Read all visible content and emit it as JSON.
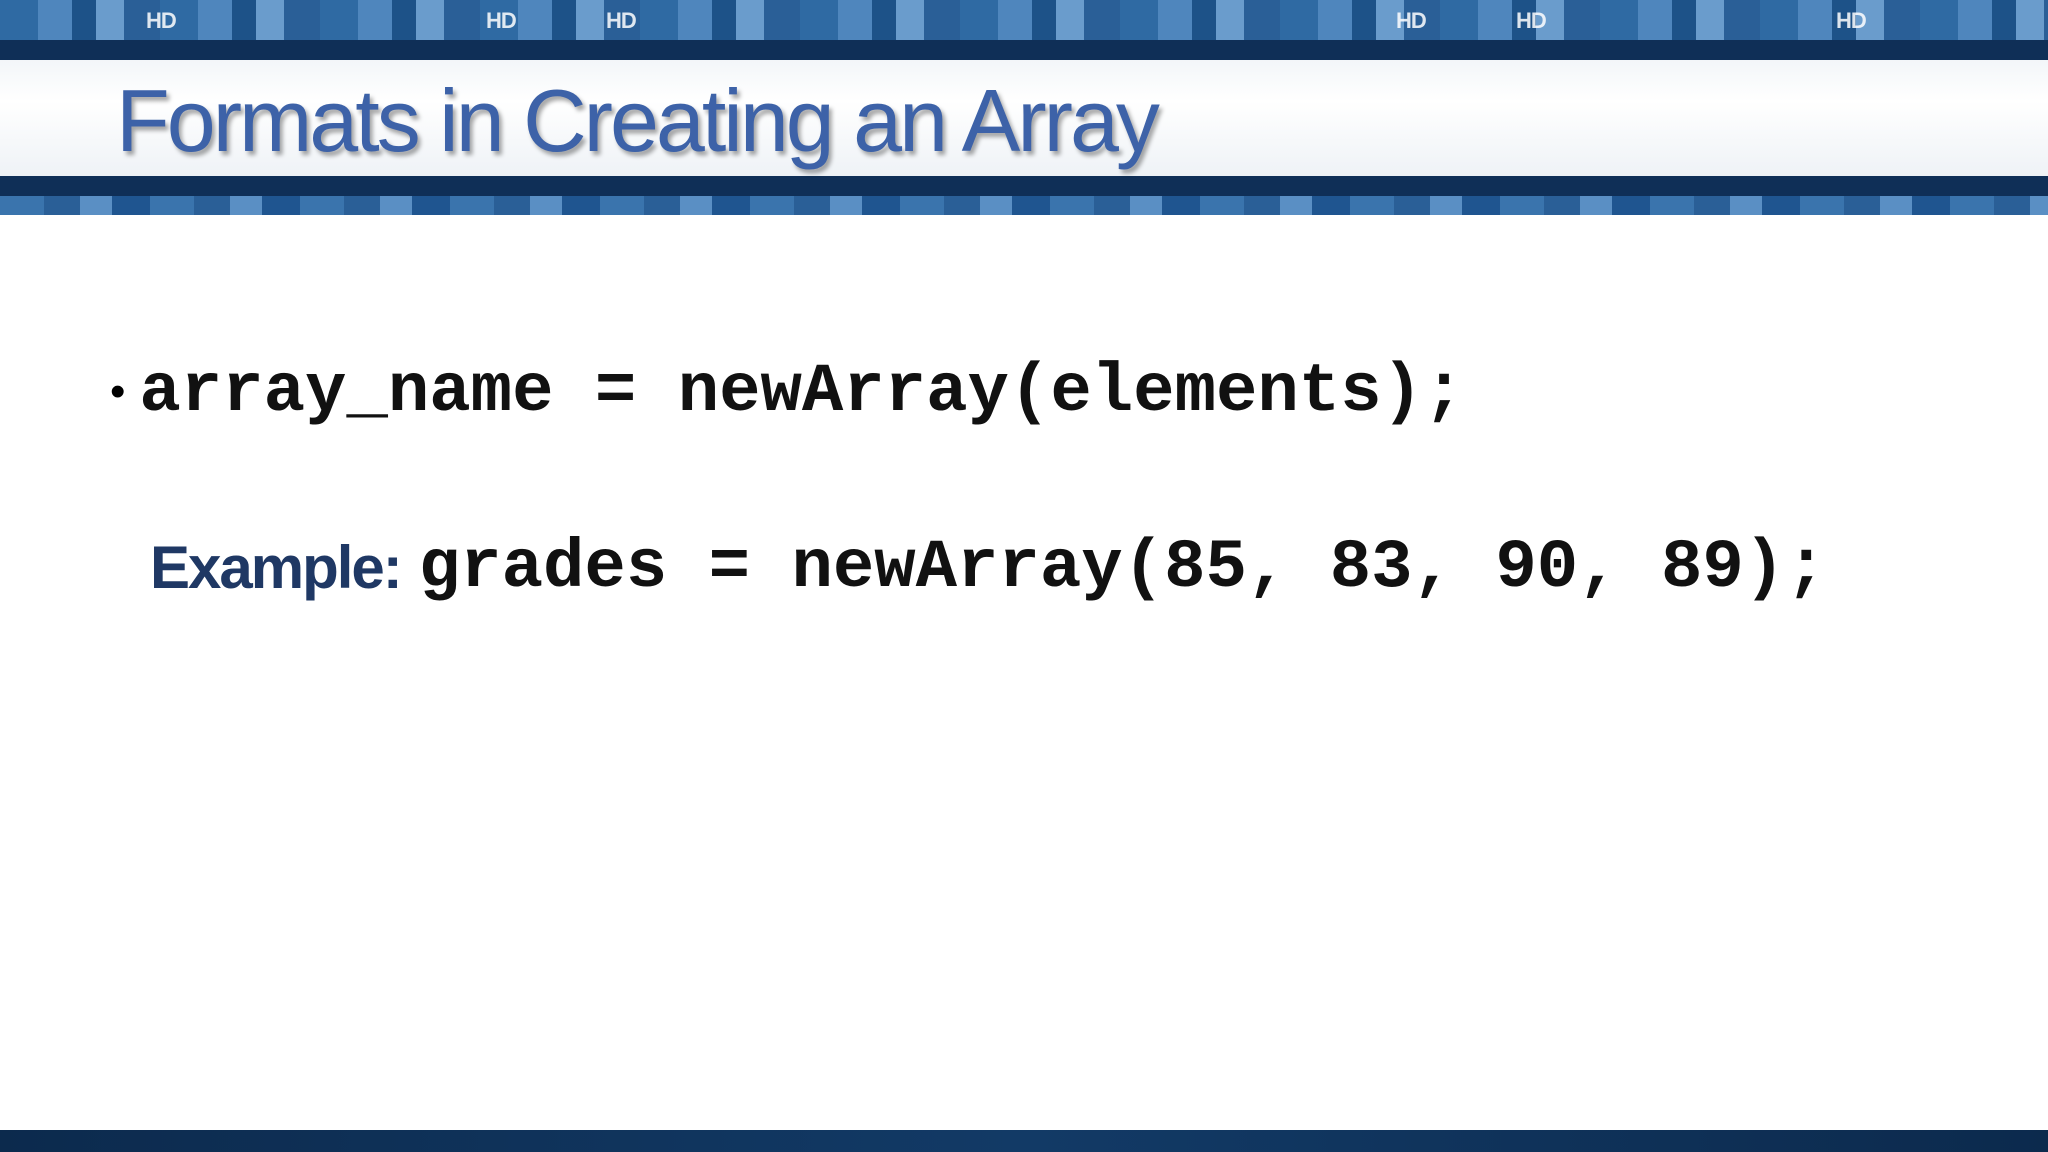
{
  "slide": {
    "title": "Formats in Creating an Array",
    "bullets": [
      {
        "bullet_symbol": "•",
        "code": "array_name = newArray(elements);"
      }
    ],
    "example": {
      "label": "Example:",
      "code": "grades = newArray(85, 83, 90, 89);"
    }
  },
  "theme": {
    "title_color": "#3d62a8",
    "banner_dark": "#0f2f57",
    "banner_blue": "#2f6aa3",
    "example_label_color": "#1f3864",
    "footer_color": "#0c2a4d"
  },
  "banner": {
    "logo_text": "HD"
  }
}
